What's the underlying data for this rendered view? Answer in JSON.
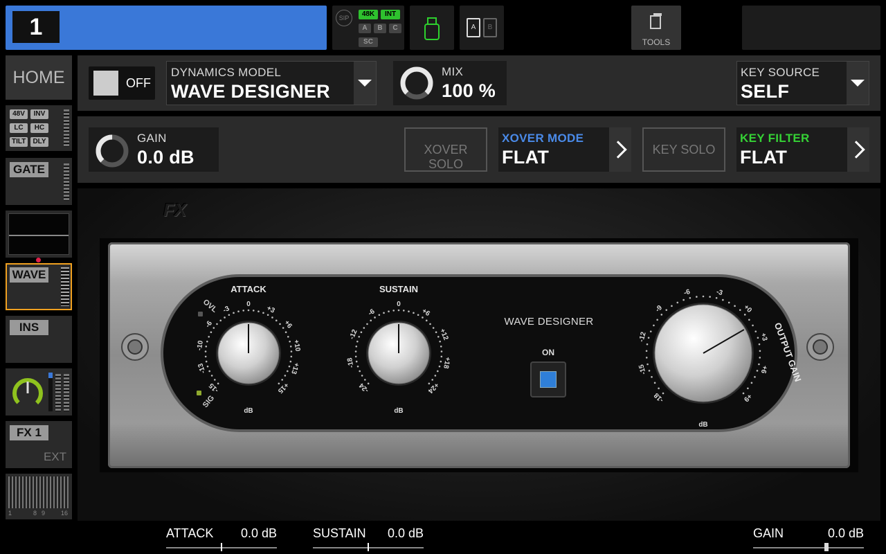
{
  "channel": {
    "number": "1",
    "color": "#3a78d8"
  },
  "status": {
    "sip": "SIP",
    "rate": "48K",
    "clock": "INT",
    "busses": [
      "A",
      "B",
      "C"
    ],
    "sc": "SC",
    "cards": [
      "A",
      "B"
    ],
    "tools": "TOOLS"
  },
  "sidebar": {
    "home": "HOME",
    "preamp_badges": [
      "48V",
      "INV",
      "LC",
      "HC",
      "TILT",
      "DLY"
    ],
    "gate": "GATE",
    "wave": "WAVE",
    "ins": "INS",
    "fx": "FX 1",
    "ext": "EXT",
    "scale": [
      "1",
      "8",
      "9",
      "16"
    ]
  },
  "row1": {
    "toggle_label": "OFF",
    "model_label": "DYNAMICS MODEL",
    "model_value": "WAVE DESIGNER",
    "mix_label": "MIX",
    "mix_value": "100 %",
    "mix_level": 1.0,
    "key_source_label": "KEY SOURCE",
    "key_source_value": "SELF"
  },
  "row2": {
    "gain_label": "GAIN",
    "gain_value": "0.0 dB",
    "xover_solo": "XOVER SOLO",
    "xover_mode_label": "XOVER MODE",
    "xover_mode_value": "FLAT",
    "key_solo": "KEY SOLO",
    "key_filter_label": "KEY FILTER",
    "key_filter_value": "FLAT",
    "xover_color": "#4a8ae8",
    "key_filter_color": "#35d235"
  },
  "plugin": {
    "logo": "FX",
    "title": "WAVE DESIGNER",
    "on_label": "ON",
    "ovl": "OVL",
    "sig": "SIG",
    "attack": {
      "label": "ATTACK",
      "unit": "dB",
      "ticks": [
        "-15",
        "-13",
        "-10",
        "-6",
        "-3",
        "0",
        "+3",
        "+6",
        "+10",
        "+13",
        "+15"
      ]
    },
    "sustain": {
      "label": "SUSTAIN",
      "unit": "dB",
      "ticks": [
        "-24",
        "-18",
        "-12",
        "-6",
        "0",
        "+6",
        "+12",
        "+18",
        "+24"
      ]
    },
    "output": {
      "label": "OUTPUT GAIN",
      "unit": "dB",
      "ticks": [
        "-18",
        "-15",
        "-12",
        "-9",
        "-6",
        "-3",
        "+0",
        "+3",
        "+6",
        "+9"
      ]
    }
  },
  "bottom": {
    "attack_label": "ATTACK",
    "attack_value": "0.0 dB",
    "attack_level": 0.5,
    "sustain_label": "SUSTAIN",
    "sustain_value": "0.0 dB",
    "sustain_level": 0.5,
    "gain_label": "GAIN",
    "gain_value": "0.0 dB",
    "gain_level": 0.66
  }
}
